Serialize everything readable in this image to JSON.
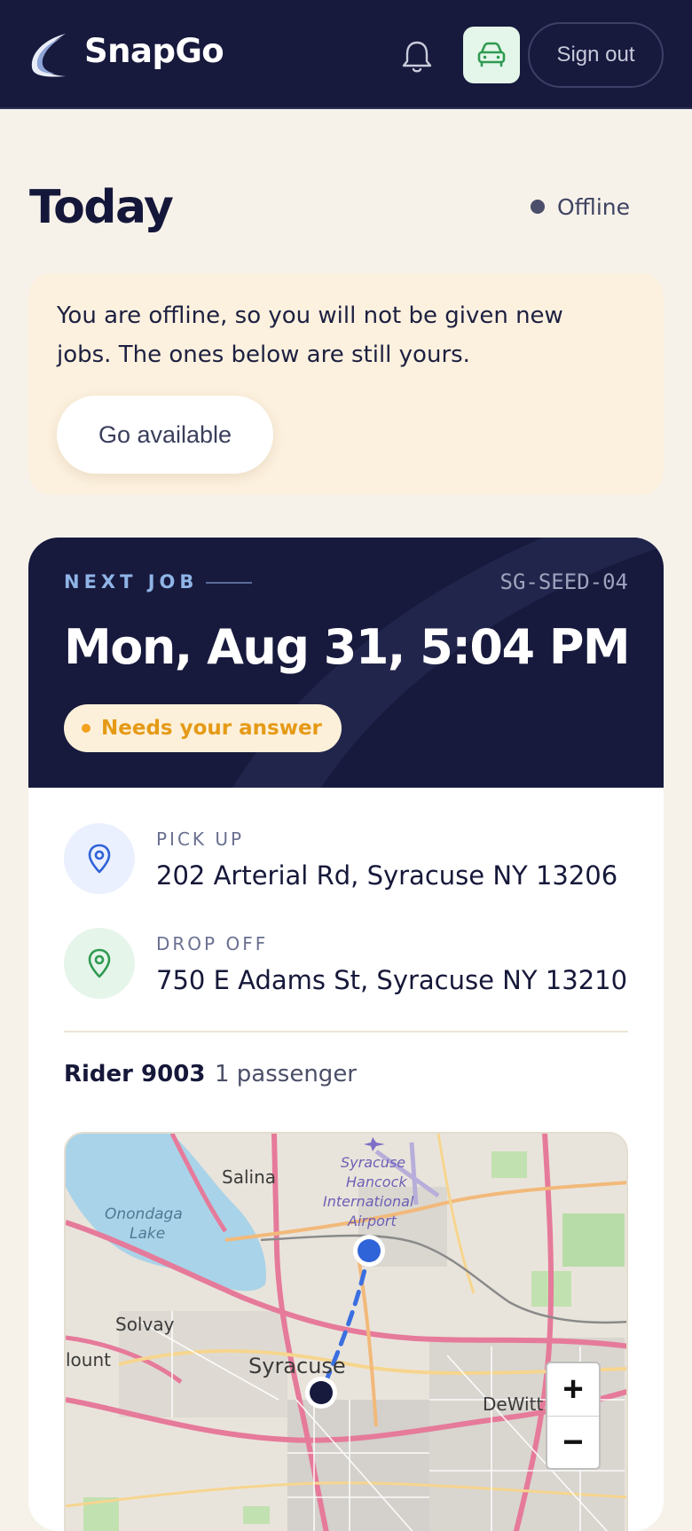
{
  "header": {
    "brand": "SnapGo",
    "sign_out_label": "Sign out",
    "icons": {
      "logo": "snapgo-swoosh-logo",
      "bell": "bell-icon",
      "vehicle": "car-icon"
    }
  },
  "page": {
    "title": "Today",
    "status_label": "Offline"
  },
  "notice": {
    "text": "You are offline, so you will not be given new jobs. The ones below are still yours.",
    "button_label": "Go available"
  },
  "job": {
    "section_label": "NEXT JOB",
    "id": "SG-SEED-04",
    "datetime": "Mon, Aug 31, 5:04 PM",
    "badge": "Needs your answer",
    "pickup": {
      "label": "PICK UP",
      "address": "202 Arterial Rd, Syracuse NY 13206"
    },
    "dropoff": {
      "label": "DROP OFF",
      "address": "750 E Adams St, Syracuse NY 13210"
    },
    "rider": "Rider 9003",
    "passengers": "1 passenger"
  },
  "map": {
    "places": {
      "salina": "Salina",
      "onondaga": "Onondaga",
      "lake": "Lake",
      "solvay": "Solvay",
      "syracuse": "Syracuse",
      "dewitt": "DeWitt",
      "mount": "lount",
      "airport1": "Syracuse",
      "airport2": "Hancock",
      "airport3": "International",
      "airport4": "Airport"
    },
    "zoom_in": "+",
    "zoom_out": "−"
  },
  "colors": {
    "navy": "#17193d",
    "cream": "#f6f2ea",
    "notice_bg": "#fcf1df",
    "accent_orange": "#e59a16",
    "pickup_blue": "#2f63d8",
    "dropoff_green": "#2f9a52"
  }
}
